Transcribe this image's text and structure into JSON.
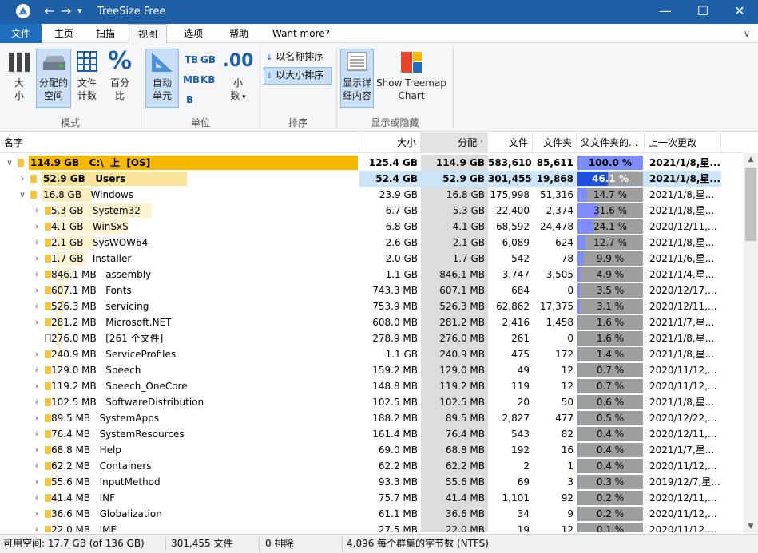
{
  "window": {
    "title": "TreeSize Free",
    "minimize": "—",
    "maximize": "☐",
    "close": "✕"
  },
  "menu": {
    "tabs": [
      "文件",
      "主页",
      "扫描",
      "视图",
      "选项",
      "帮助",
      "Want more?"
    ],
    "collapse": "∨"
  },
  "ribbon": {
    "groups": {
      "mode": "模式",
      "unit": "单位",
      "sort": "排序",
      "show_hide": "显示或隐藏"
    },
    "size_label_1": "大",
    "size_label_2": "小",
    "allocated_label_1": "分配的",
    "allocated_label_2": "空间",
    "file_count_label_1": "文件",
    "file_count_label_2": "计数",
    "percent_label_1": "百分",
    "percent_label_2": "比",
    "auto_unit_label_1": "自动",
    "auto_unit_label_2": "单元",
    "tb": "TB",
    "gb": "GB",
    "mb": "MB",
    "kb": "KB",
    "b": "B",
    "decimals_label_1": "小",
    "decimals_label_2": "数",
    "decimals_glyph": ".00",
    "sort_by_name": "以名称排序",
    "sort_by_size": "以大小排序",
    "show_details_1": "显示详",
    "show_details_2": "细内容",
    "treemap_1": "Show Treemap",
    "treemap_2": "Chart",
    "percent_glyph": "%"
  },
  "columns": [
    "名字",
    "大小",
    "分配",
    "文件",
    "文件夹",
    "父文件夹的...",
    "上一次更改"
  ],
  "rows": [
    {
      "indent": 0,
      "chevron": "∨",
      "label": "114.9 GB   C:\\  上  [OS]",
      "size": "125.4 GB",
      "alloc": "114.9 GB",
      "files": "583,610",
      "folders": "85,611",
      "pct": "100.0 %",
      "pct_value": 100.0,
      "date": "2021/1/8,星...",
      "namebar": 1.0,
      "bar_color": "#f5b800",
      "bold": true,
      "file": false
    },
    {
      "indent": 1,
      "chevron": "›",
      "label": "52.9 GB   Users",
      "size": "52.4 GB",
      "alloc": "52.9 GB",
      "files": "301,455",
      "folders": "19,868",
      "pct": "46.1 %",
      "pct_value": 46.1,
      "date": "2021/1/8,星...",
      "namebar": 0.46,
      "bar_color": "#f7e39a",
      "bold": true,
      "selected": true,
      "file": false
    },
    {
      "indent": 1,
      "chevron": "∨",
      "label": "16.8 GB   Windows",
      "size": "23.9 GB",
      "alloc": "16.8 GB",
      "files": "175,998",
      "folders": "51,316",
      "pct": "14.7 %",
      "pct_value": 14.7,
      "date": "2021/1/8,星...",
      "namebar": 0.16,
      "bar_color": "#fbecc0",
      "file": false
    },
    {
      "indent": 2,
      "chevron": "›",
      "label": "5.3 GB   System32",
      "size": "6.7 GB",
      "alloc": "5.3 GB",
      "files": "22,400",
      "folders": "2,374",
      "pct": "31.6 %",
      "pct_value": 31.6,
      "date": "2021/1/8,星...",
      "namebar": 0.32,
      "bar_color": "#fdf3d0",
      "file": false
    },
    {
      "indent": 2,
      "chevron": "›",
      "label": "4.1 GB   WinSxS",
      "size": "6.8 GB",
      "alloc": "4.1 GB",
      "files": "68,592",
      "folders": "24,478",
      "pct": "24.1 %",
      "pct_value": 24.1,
      "date": "2020/12/11,...",
      "namebar": 0.24,
      "bar_color": "#fdf3d0",
      "file": false
    },
    {
      "indent": 2,
      "chevron": "›",
      "label": "2.1 GB   SysWOW64",
      "size": "2.6 GB",
      "alloc": "2.1 GB",
      "files": "6,089",
      "folders": "624",
      "pct": "12.7 %",
      "pct_value": 12.7,
      "date": "2021/1/8,星...",
      "namebar": 0.13,
      "bar_color": "#fdf3d0",
      "file": false
    },
    {
      "indent": 2,
      "chevron": "›",
      "label": "1.7 GB   Installer",
      "size": "2.0 GB",
      "alloc": "1.7 GB",
      "files": "542",
      "folders": "78",
      "pct": "9.9 %",
      "pct_value": 9.9,
      "date": "2021/1/6,星...",
      "namebar": 0.1,
      "bar_color": "#fdf3d0",
      "file": false
    },
    {
      "indent": 2,
      "chevron": "›",
      "label": "846.1 MB   assembly",
      "size": "1.1 GB",
      "alloc": "846.1 MB",
      "files": "3,747",
      "folders": "3,505",
      "pct": "4.9 %",
      "pct_value": 4.9,
      "date": "2021/1/4,星...",
      "namebar": 0.05,
      "bar_color": "#fdf3d0",
      "file": false
    },
    {
      "indent": 2,
      "chevron": "›",
      "label": "607.1 MB   Fonts",
      "size": "743.3 MB",
      "alloc": "607.1 MB",
      "files": "684",
      "folders": "0",
      "pct": "3.5 %",
      "pct_value": 3.5,
      "date": "2020/12/17,...",
      "namebar": 0.035,
      "bar_color": "#fdf3d0",
      "file": false
    },
    {
      "indent": 2,
      "chevron": "›",
      "label": "526.3 MB   servicing",
      "size": "753.9 MB",
      "alloc": "526.3 MB",
      "files": "62,862",
      "folders": "17,375",
      "pct": "3.1 %",
      "pct_value": 3.1,
      "date": "2020/12/11,...",
      "namebar": 0.03,
      "bar_color": "#fdf3d0",
      "file": false
    },
    {
      "indent": 2,
      "chevron": "›",
      "label": "281.2 MB   Microsoft.NET",
      "size": "608.0 MB",
      "alloc": "281.2 MB",
      "files": "2,416",
      "folders": "1,458",
      "pct": "1.6 %",
      "pct_value": 1.6,
      "date": "2021/1/7,星...",
      "namebar": 0.02,
      "bar_color": "#fdf3d0",
      "file": false
    },
    {
      "indent": 2,
      "chevron": "",
      "label": "276.0 MB   [261 个文件]",
      "size": "278.9 MB",
      "alloc": "276.0 MB",
      "files": "261",
      "folders": "0",
      "pct": "1.6 %",
      "pct_value": 1.6,
      "date": "2021/1/8,星...",
      "namebar": 0.02,
      "bar_color": "#fdf3d0",
      "file": true
    },
    {
      "indent": 2,
      "chevron": "›",
      "label": "240.9 MB   ServiceProfiles",
      "size": "1.1 GB",
      "alloc": "240.9 MB",
      "files": "475",
      "folders": "172",
      "pct": "1.4 %",
      "pct_value": 1.4,
      "date": "2021/1/8,星...",
      "namebar": 0.015,
      "bar_color": "#fdf3d0",
      "file": false
    },
    {
      "indent": 2,
      "chevron": "›",
      "label": "129.0 MB   Speech",
      "size": "159.2 MB",
      "alloc": "129.0 MB",
      "files": "49",
      "folders": "12",
      "pct": "0.7 %",
      "pct_value": 0.7,
      "date": "2020/11/12,...",
      "namebar": 0.0,
      "bar_color": "#fdf3d0",
      "file": false
    },
    {
      "indent": 2,
      "chevron": "›",
      "label": "119.2 MB   Speech_OneCore",
      "size": "148.8 MB",
      "alloc": "119.2 MB",
      "files": "119",
      "folders": "12",
      "pct": "0.7 %",
      "pct_value": 0.7,
      "date": "2020/11/12,...",
      "namebar": 0.0,
      "bar_color": "#fdf3d0",
      "file": false
    },
    {
      "indent": 2,
      "chevron": "›",
      "label": "102.5 MB   SoftwareDistribution",
      "size": "102.5 MB",
      "alloc": "102.5 MB",
      "files": "20",
      "folders": "50",
      "pct": "0.6 %",
      "pct_value": 0.6,
      "date": "2021/1/8,星...",
      "namebar": 0.0,
      "bar_color": "#fdf3d0",
      "file": false
    },
    {
      "indent": 2,
      "chevron": "›",
      "label": "89.5 MB   SystemApps",
      "size": "188.2 MB",
      "alloc": "89.5 MB",
      "files": "2,827",
      "folders": "477",
      "pct": "0.5 %",
      "pct_value": 0.5,
      "date": "2020/12/22,...",
      "namebar": 0.0,
      "bar_color": "#fdf3d0",
      "file": false
    },
    {
      "indent": 2,
      "chevron": "›",
      "label": "76.4 MB   SystemResources",
      "size": "161.4 MB",
      "alloc": "76.4 MB",
      "files": "543",
      "folders": "82",
      "pct": "0.4 %",
      "pct_value": 0.4,
      "date": "2020/12/11,...",
      "namebar": 0.0,
      "bar_color": "#fdf3d0",
      "file": false
    },
    {
      "indent": 2,
      "chevron": "›",
      "label": "68.8 MB   Help",
      "size": "69.0 MB",
      "alloc": "68.8 MB",
      "files": "192",
      "folders": "16",
      "pct": "0.4 %",
      "pct_value": 0.4,
      "date": "2021/1/7,星...",
      "namebar": 0.0,
      "bar_color": "#fdf3d0",
      "file": false
    },
    {
      "indent": 2,
      "chevron": "›",
      "label": "62.2 MB   Containers",
      "size": "62.2 MB",
      "alloc": "62.2 MB",
      "files": "2",
      "folders": "1",
      "pct": "0.4 %",
      "pct_value": 0.4,
      "date": "2020/11/12,...",
      "namebar": 0.0,
      "bar_color": "#fdf3d0",
      "file": false
    },
    {
      "indent": 2,
      "chevron": "›",
      "label": "55.6 MB   InputMethod",
      "size": "93.3 MB",
      "alloc": "55.6 MB",
      "files": "69",
      "folders": "3",
      "pct": "0.3 %",
      "pct_value": 0.3,
      "date": "2019/12/7,星...",
      "namebar": 0.0,
      "bar_color": "#fdf3d0",
      "file": false
    },
    {
      "indent": 2,
      "chevron": "›",
      "label": "41.4 MB   INF",
      "size": "75.7 MB",
      "alloc": "41.4 MB",
      "files": "1,101",
      "folders": "92",
      "pct": "0.2 %",
      "pct_value": 0.2,
      "date": "2020/12/11,...",
      "namebar": 0.0,
      "bar_color": "#fdf3d0",
      "file": false
    },
    {
      "indent": 2,
      "chevron": "›",
      "label": "36.6 MB   Globalization",
      "size": "61.1 MB",
      "alloc": "36.6 MB",
      "files": "34",
      "folders": "9",
      "pct": "0.2 %",
      "pct_value": 0.2,
      "date": "2020/11/12,...",
      "namebar": 0.0,
      "bar_color": "#fdf3d0",
      "file": false
    },
    {
      "indent": 2,
      "chevron": "›",
      "label": "22.0 MB   IME",
      "size": "27.5 MB",
      "alloc": "22.0 MB",
      "files": "19",
      "folders": "12",
      "pct": "0.1 %",
      "pct_value": 0.1,
      "date": "2020/11/12,...",
      "namebar": 0.0,
      "bar_color": "#fdf3d0",
      "file": false
    }
  ],
  "status": {
    "free_space": "可用空间: 17.7 GB  (of 136 GB)",
    "files": "301,455 文件",
    "excluded": "0 排除",
    "cluster": "4,096 每个群集的字节数 (NTFS)"
  },
  "colors": {
    "title_bar": "#1f5fa8",
    "file_tab": "#1f6fbf",
    "selected_row": "#cce4f7",
    "percent_bar": "#7d8dff",
    "root_bar": "#f5b800"
  }
}
